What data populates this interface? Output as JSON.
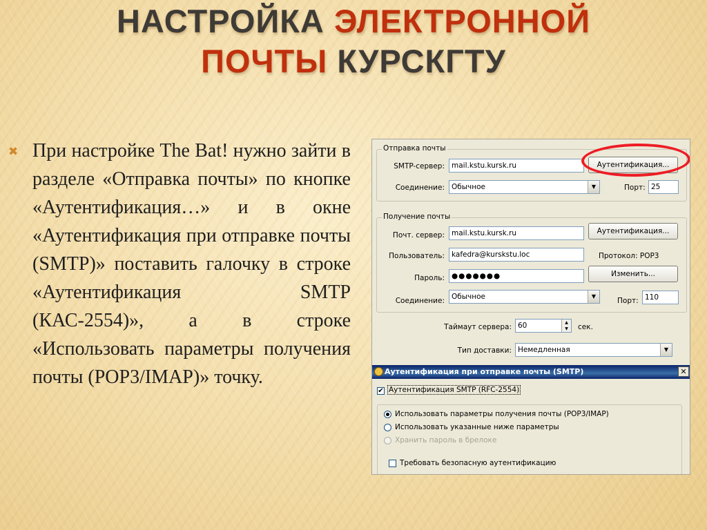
{
  "title": {
    "line1_plain": "НАСТРОЙКА ",
    "line1_accent": "ЭЛЕКТРОННОЙ",
    "line2_accent": "ПОЧТЫ",
    "line2_plain": " КУРСКГТУ"
  },
  "bullet": {
    "icon": "orange-x-bullet-icon",
    "text": "При настройке The Bat! нужно зайти в разделе «Отправка почты» по кнопке «Аутентификация…» и в окне «Аутентификация при отправке почты (SMTP)» поставить галочку в строке «Аутентификация SMTP (КАС-2554)», а в строке «Использовать параметры получения почты (POP3/IMAP)» точку."
  },
  "colors": {
    "accent": "#c0300d",
    "title_text": "#3e3a36",
    "highlight_ring": "#ee1c24",
    "dialog_titlebar": "#0a246a"
  },
  "screenshot": {
    "send": {
      "legend": "Отправка почты",
      "smtp_label": "SMTP-сервер:",
      "smtp_value": "mail.kstu.kursk.ru",
      "auth_button": "Аутентификация...",
      "conn_label": "Соединение:",
      "conn_value": "Обычное",
      "port_label": "Порт:",
      "port_value": "25"
    },
    "receive": {
      "legend": "Получение почты",
      "server_label": "Почт. сервер:",
      "server_value": "mail.kstu.kursk.ru",
      "auth_button": "Аутентификация...",
      "user_label": "Пользователь:",
      "user_value": "kafedra@kurskstu.loc",
      "protocol_text": "Протокол: POP3",
      "password_label": "Пароль:",
      "password_value": "●●●●●●●",
      "change_button": "Изменить...",
      "conn_label": "Соединение:",
      "conn_value": "Обычное",
      "port_label": "Порт:",
      "port_value": "110"
    },
    "timeout_label": "Таймаут сервера:",
    "timeout_value": "60",
    "timeout_unit": "сек.",
    "delivery_label": "Тип доставки:",
    "delivery_value": "Немедленная",
    "dialog": {
      "title": "Аутентификация при отправке почты (SMTP)",
      "close": "✕",
      "smtp_auth_check": "Аутентификация SMTP (RFC-2554)",
      "radio_use_receive": "Использовать параметры получения почты (POP3/IMAP)",
      "radio_use_below": "Использовать указанные ниже параметры",
      "radio_keep_password": "Хранить пароль в брелоке",
      "require_secure": "Требовать безопасную аутентификацию"
    }
  }
}
